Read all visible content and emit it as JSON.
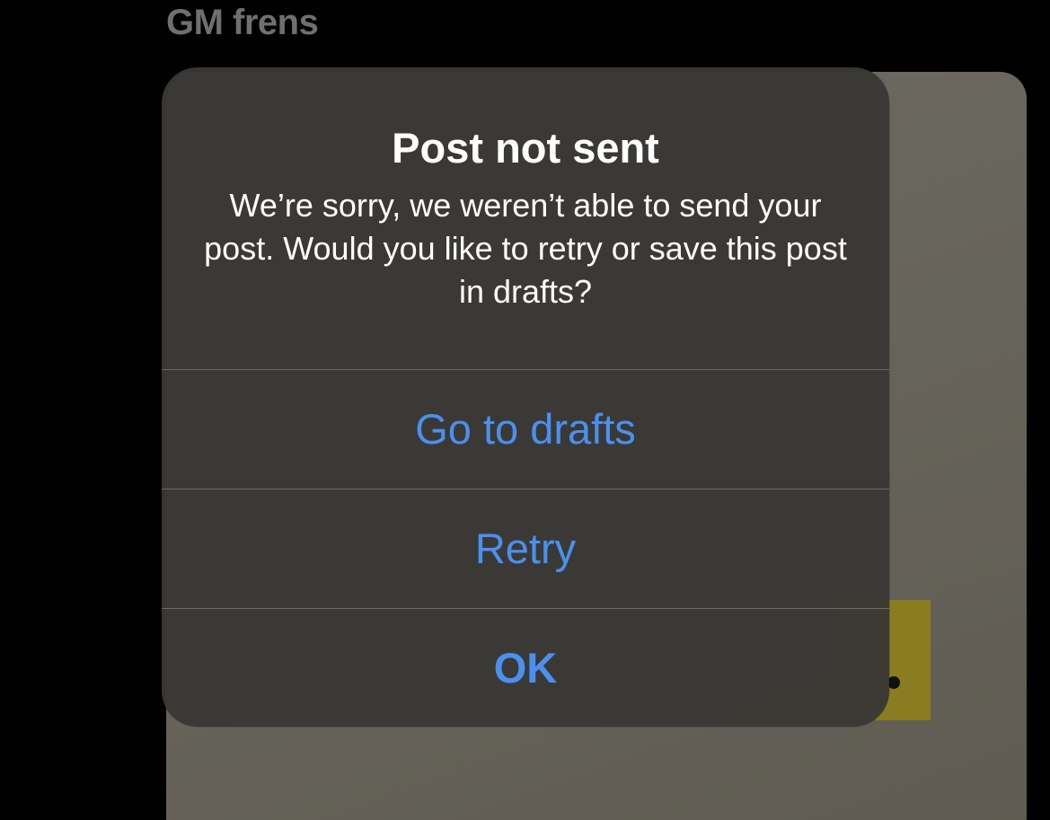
{
  "post": {
    "text": "GM frens"
  },
  "alert": {
    "title": "Post not sent",
    "message": "We’re sorry, we weren’t able to send your post. Would you like to retry or save this post in drafts?",
    "buttons": {
      "drafts_label": "Go to drafts",
      "retry_label": "Retry",
      "ok_label": "OK"
    }
  },
  "colors": {
    "background": "#000000",
    "alert_background": "#3a3834",
    "button_text": "#4a90f0",
    "post_text": "#6f6f6f"
  }
}
